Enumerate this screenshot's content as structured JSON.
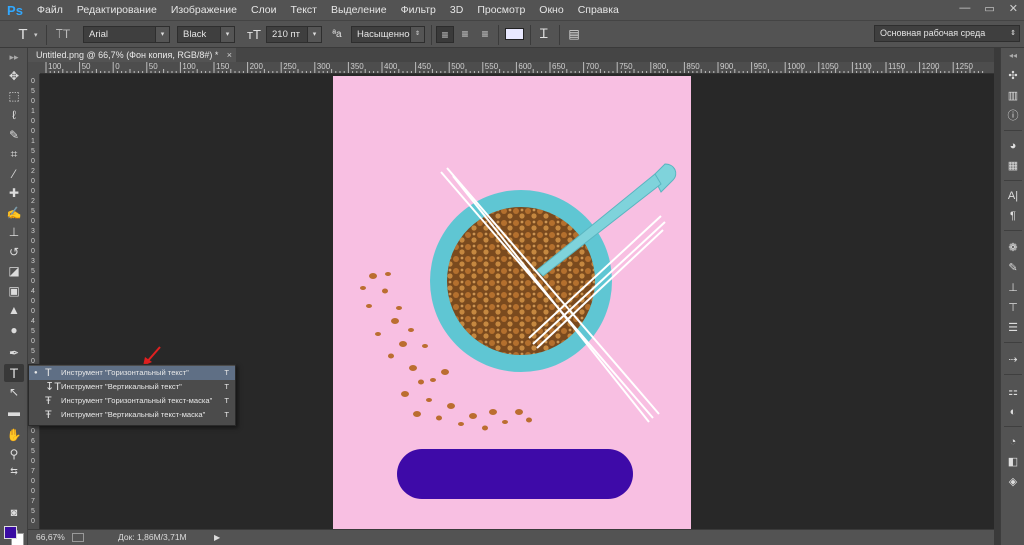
{
  "app": {
    "logo": "Ps"
  },
  "menu": [
    "Файл",
    "Редактирование",
    "Изображение",
    "Слои",
    "Текст",
    "Выделение",
    "Фильтр",
    "3D",
    "Просмотр",
    "Окно",
    "Справка"
  ],
  "window_controls": [
    "—",
    "▭",
    "✕"
  ],
  "options": {
    "font_family": "Arial",
    "font_style": "Black",
    "font_size": "210 пт",
    "antialias_icon_text": "ªa",
    "antialias": "Насыщенное",
    "text_color": "#e8e8ff"
  },
  "workspace": {
    "label": "Основная рабочая среда"
  },
  "document_tab": {
    "title": "Untitled.png @ 66,7% (Фон копия, RGB/8#) *",
    "close": "×"
  },
  "ruler_h": [
    "100",
    "50",
    "0",
    "50",
    "100",
    "150",
    "200",
    "250",
    "300",
    "350",
    "400",
    "450",
    "500",
    "550",
    "600",
    "650",
    "700",
    "750",
    "800",
    "850",
    "900",
    "950",
    "1000",
    "1050",
    "1100",
    "1150",
    "1200",
    "1250"
  ],
  "ruler_v": [
    "0",
    "5",
    "0",
    "1",
    "0",
    "0",
    "1",
    "5",
    "0",
    "2",
    "0",
    "0",
    "2",
    "5",
    "0",
    "3",
    "0",
    "0",
    "3",
    "5",
    "0",
    "4",
    "0",
    "0",
    "4",
    "5",
    "0",
    "5",
    "0",
    "0",
    "5",
    "5",
    "0",
    "6",
    "0",
    "0",
    "6",
    "5",
    "0",
    "7",
    "0",
    "0",
    "7",
    "5",
    "0"
  ],
  "type_flyout": [
    {
      "label": "Инструмент \"Горизонтальный текст\"",
      "key": "T",
      "selected": true
    },
    {
      "label": "Инструмент \"Вертикальный текст\"",
      "key": "T",
      "selected": false
    },
    {
      "label": "Инструмент \"Горизонтальный текст-маска\"",
      "key": "T",
      "selected": false
    },
    {
      "label": "Инструмент \"Вертикальный текст-маска\"",
      "key": "T",
      "selected": false
    }
  ],
  "colors": {
    "foreground": "#3a0ca3",
    "background": "#ffffff",
    "canvas_bg": "#f8bfe2",
    "bowl": "#5ec8d2",
    "pill": "#3e0aa8"
  },
  "status": {
    "zoom": "66,67%",
    "doc": "Док: 1,86M/3,71M"
  }
}
